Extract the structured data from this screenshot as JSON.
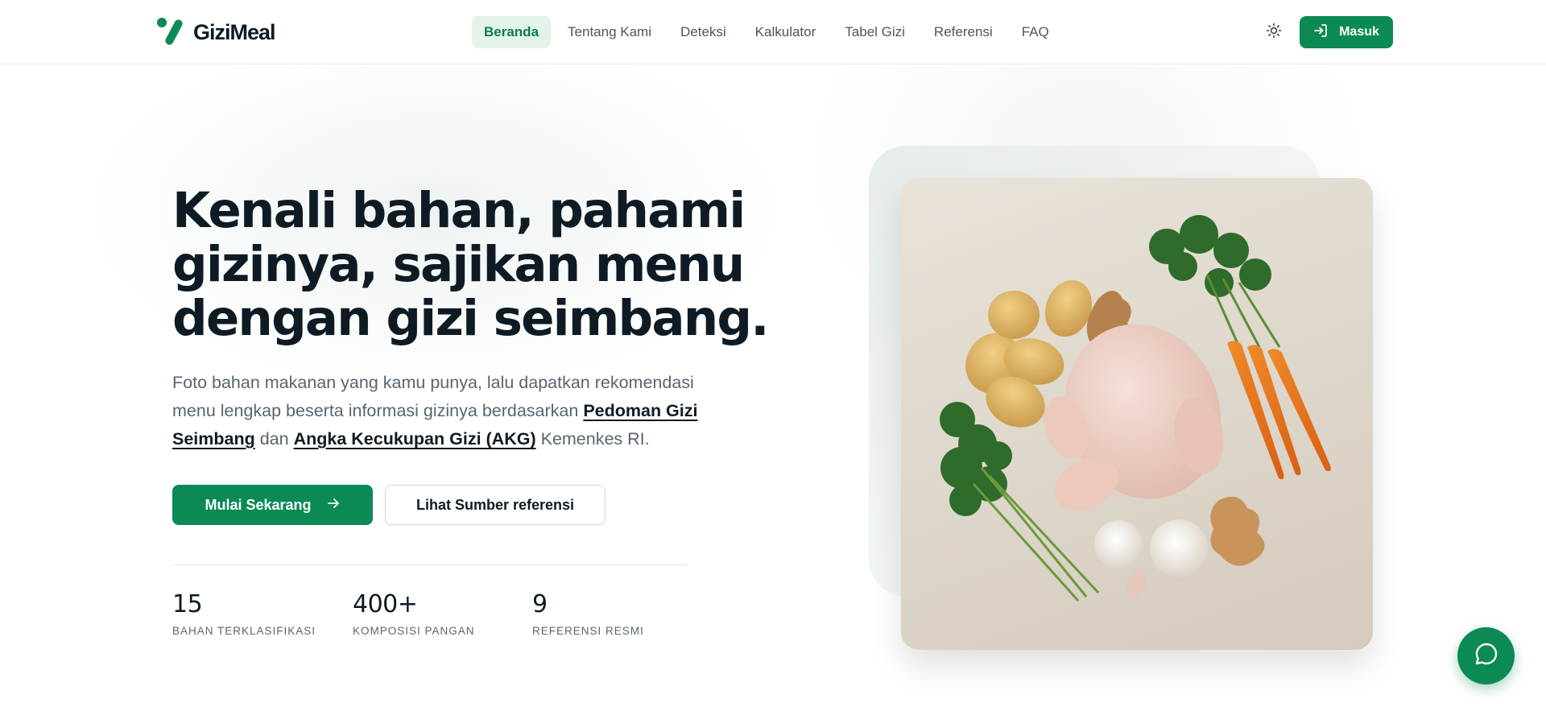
{
  "brand": {
    "name": "GiziMeal",
    "logo_icon": "gizimeal-logo-icon",
    "accent_color": "#0b8a55"
  },
  "nav": {
    "items": [
      {
        "label": "Beranda",
        "active": true
      },
      {
        "label": "Tentang Kami",
        "active": false
      },
      {
        "label": "Deteksi",
        "active": false
      },
      {
        "label": "Kalkulator",
        "active": false
      },
      {
        "label": "Tabel Gizi",
        "active": false
      },
      {
        "label": "Referensi",
        "active": false
      },
      {
        "label": "FAQ",
        "active": false
      }
    ],
    "theme_icon": "sun-icon",
    "login_label": "Masuk",
    "login_icon": "login-icon"
  },
  "hero": {
    "headline": "Kenali bahan, pahami gizinya, sajikan menu dengan gizi seimbang.",
    "subtext_part1": "Foto bahan makanan yang kamu punya, lalu dapatkan rekomendasi menu lengkap beserta informasi gizinya berdasarkan ",
    "link1": "Pedoman Gizi Seimbang",
    "subtext_part2": " dan ",
    "link2": "Angka Kecukupan Gizi (AKG)",
    "subtext_part3": " Kemenkes RI.",
    "primary_button": "Mulai Sekarang",
    "secondary_button": "Lihat Sumber referensi"
  },
  "stats": [
    {
      "value": "15",
      "label": "BAHAN TERKLASIFIKASI"
    },
    {
      "value": "400+",
      "label": "KOMPOSISI PANGAN"
    },
    {
      "value": "9",
      "label": "REFERENSI RESMI"
    }
  ],
  "chat": {
    "icon": "chat-bubble-icon"
  }
}
